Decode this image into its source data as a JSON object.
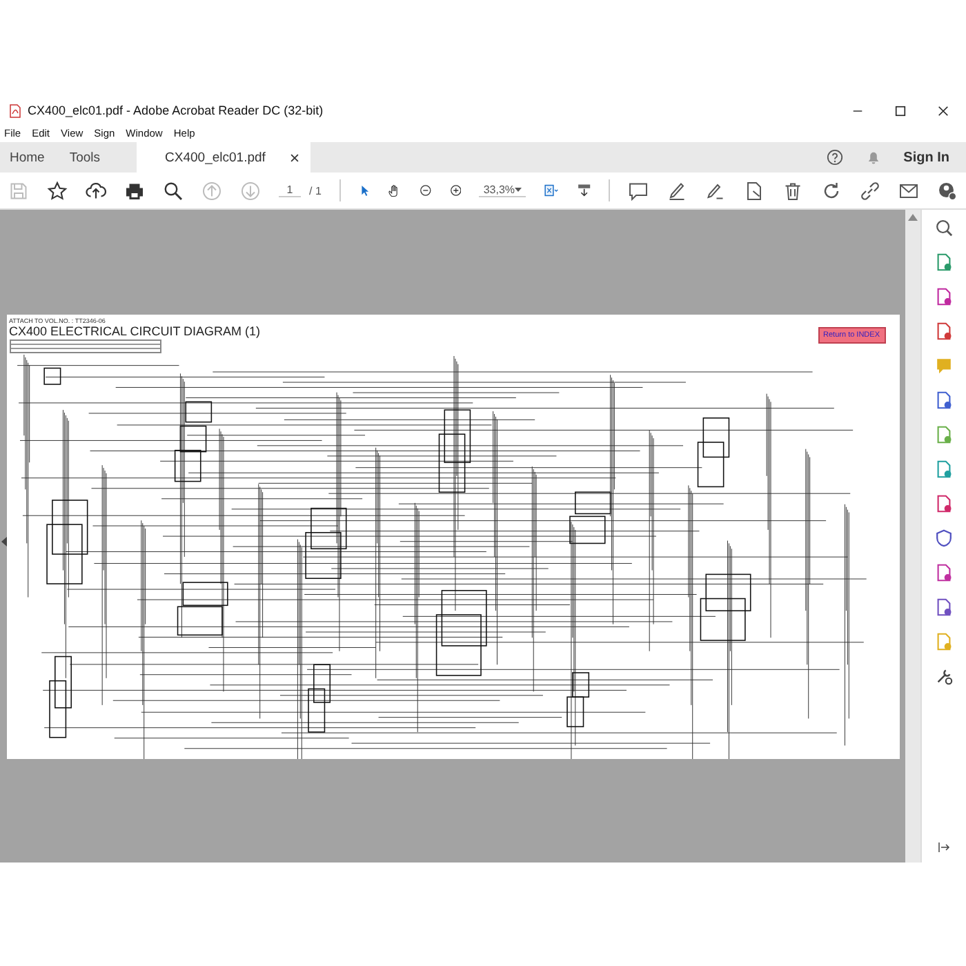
{
  "window": {
    "title": "CX400_elc01.pdf - Adobe Acrobat Reader DC (32-bit)"
  },
  "menu": [
    "File",
    "Edit",
    "View",
    "Sign",
    "Window",
    "Help"
  ],
  "tabs": [
    {
      "label": "Home",
      "selected": false
    },
    {
      "label": "Tools",
      "selected": false
    },
    {
      "label": "CX400_elc01.pdf",
      "selected": true
    }
  ],
  "account": {
    "sign_in": "Sign In"
  },
  "toolbar": {
    "items": [
      {
        "kind": "save",
        "disabled": true
      },
      {
        "kind": "star",
        "disabled": false
      },
      {
        "kind": "upload",
        "disabled": false
      },
      {
        "kind": "print",
        "disabled": false
      },
      {
        "kind": "search",
        "disabled": false
      },
      {
        "kind": "up",
        "disabled": true
      },
      {
        "kind": "down",
        "disabled": true
      }
    ],
    "page_number": "1",
    "page_total": "/ 1",
    "zoom": "33,3%"
  },
  "document": {
    "attach_note": "ATTACH TO VOL.NO. : TT2346-06",
    "title": "CX400 ELECTRICAL CIRCUIT DIAGRAM (1)",
    "return_button": "Return to INDEX"
  }
}
